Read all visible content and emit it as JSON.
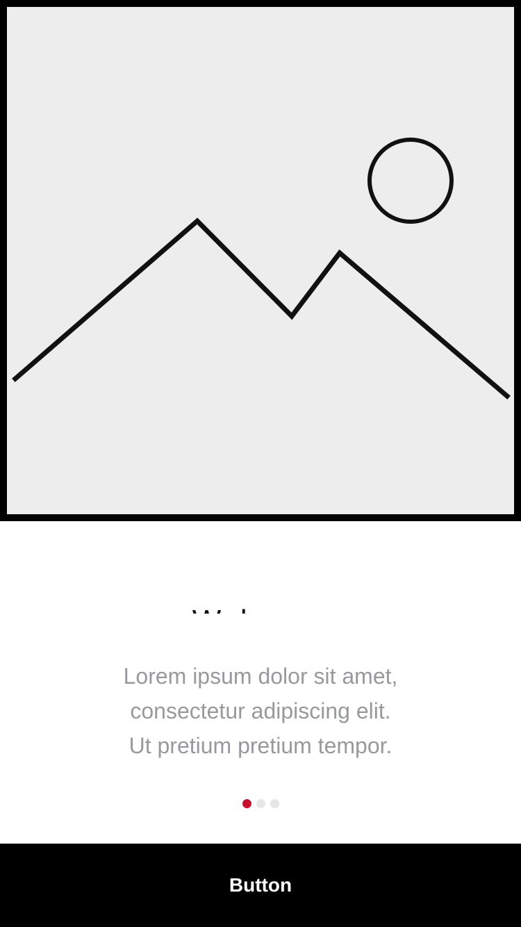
{
  "hero": {
    "icon": "image-placeholder-icon",
    "frame_color": "#000000",
    "background_color": "#ededed"
  },
  "welcome": {
    "title": "Welcome",
    "body_lines": [
      "Lorem ipsum dolor sit amet,",
      "consectetur adipiscing elit.",
      "Ut pretium pretium tempor."
    ],
    "text_color": "#98999e"
  },
  "pager": {
    "page_count": 3,
    "current_page": 1,
    "active_color": "#c8102e",
    "inactive_color": "#e6e6e6"
  },
  "footer": {
    "button_label": "Button",
    "button_color": "#000000"
  }
}
